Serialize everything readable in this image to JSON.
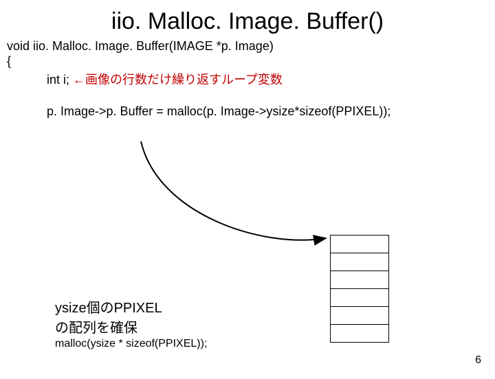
{
  "title": "iio. Malloc. Image. Buffer()",
  "code": {
    "signature": "void iio. Malloc. Image. Buffer(IMAGE *p. Image)",
    "open_brace": "{",
    "line1_left": "int i; ",
    "line1_red": "←画像の行数だけ繰り返すループ変数",
    "line2": "p. Image->p. Buffer = malloc(p. Image->ysize*sizeof(PPIXEL));"
  },
  "caption": {
    "l1": "ysize個のPPIXEL",
    "l2": "の配列を確保",
    "l3": "malloc(ysize * sizeof(PPIXEL));"
  },
  "page_number": "6",
  "array_cells": 6
}
